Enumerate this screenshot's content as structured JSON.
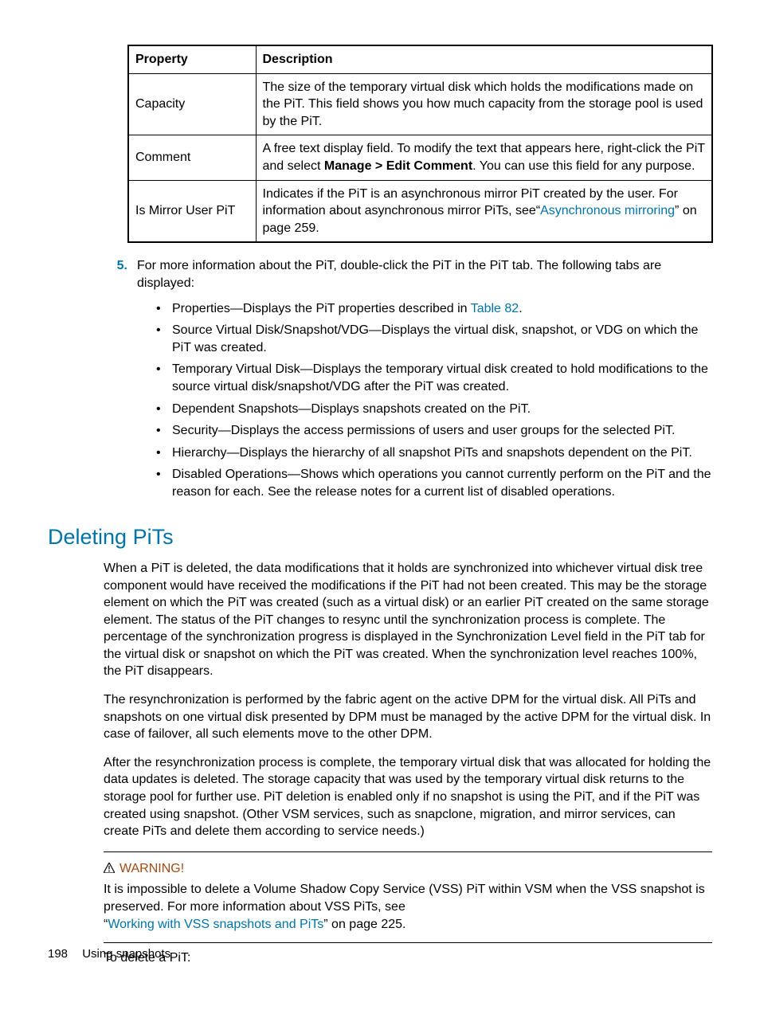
{
  "table": {
    "head": {
      "c1": "Property",
      "c2": "Description"
    },
    "rows": [
      {
        "c1": "Capacity",
        "c2": "The size of the temporary virtual disk which holds the modifications made on the PiT. This field shows you how much capacity from the storage pool is used by the PiT."
      },
      {
        "c1": "Comment",
        "c2_a": "A free text display field. To modify the text that appears here, right-click the PiT and select ",
        "c2_bold": "Manage > Edit Comment",
        "c2_b": ". You can use this field for any purpose."
      },
      {
        "c1": "Is Mirror User PiT",
        "c2_a": "Indicates if the PiT is an asynchronous mirror PiT created by the user. For information about asynchronous mirror PiTs, see“",
        "c2_link": "Asynchronous mirroring",
        "c2_b": "” on page 259."
      }
    ]
  },
  "step": {
    "num": "5.",
    "intro": "For more information about the PiT, double-click the PiT in the PiT tab. The following tabs are displayed:",
    "bullets": {
      "b0_a": "Properties—Displays the PiT properties described in ",
      "b0_link": "Table 82",
      "b0_b": ".",
      "b1": "Source Virtual Disk/Snapshot/VDG—Displays the virtual disk, snapshot, or VDG on which the PiT was created.",
      "b2": "Temporary Virtual Disk—Displays the temporary virtual disk created to hold modifications to the source virtual disk/snapshot/VDG after the PiT was created.",
      "b3": "Dependent Snapshots—Displays snapshots created on the PiT.",
      "b4": "Security—Displays the access permissions of users and user groups for the selected PiT.",
      "b5": "Hierarchy—Displays the hierarchy of all snapshot PiTs and snapshots dependent on the PiT.",
      "b6": "Disabled Operations—Shows which operations you cannot currently perform on the PiT and the reason for each. See the release notes for a current list of disabled operations."
    }
  },
  "heading": "Deleting PiTs",
  "para1": "When a PiT is deleted, the data modifications that it holds are synchronized into whichever virtual disk tree component would have received the modifications if the PiT had not been created. This may be the storage element on which the PiT was created (such as a virtual disk) or an earlier PiT created on the same storage element. The status of the PiT changes to resync until the synchronization process is complete. The percentage of the synchronization progress is displayed in the Synchronization Level field in the PiT tab for the virtual disk or snapshot on which the PiT was created. When the synchronization level reaches 100%, the PiT disappears.",
  "para2": "The resynchronization is performed by the fabric agent on the active DPM for the virtual disk. All PiTs and snapshots on one virtual disk presented by DPM must be managed by the active DPM for the virtual disk. In case of failover, all such elements move to the other DPM.",
  "para3": "After the resynchronization process is complete, the temporary virtual disk that was allocated for holding the data updates is deleted. The storage capacity that was used by the temporary virtual disk returns to the storage pool for further use. PiT deletion is enabled only if no snapshot is using the PiT, and if the PiT was created using snapshot. (Other VSM services, such as snapclone, migration, and mirror services, can create PiTs and delete them according to service needs.)",
  "warning": {
    "label": "WARNING!",
    "line1": "It is impossible to delete a Volume Shadow Copy Service (VSS) PiT within VSM when the VSS snapshot is preserved. For more information about VSS PiTs, see",
    "link_pre": "“",
    "link": "Working with VSS snapshots and PiTs",
    "link_post": "” on page 225."
  },
  "para4": "To delete a PiT:",
  "footer": {
    "page": "198",
    "section": "Using snapshots"
  }
}
